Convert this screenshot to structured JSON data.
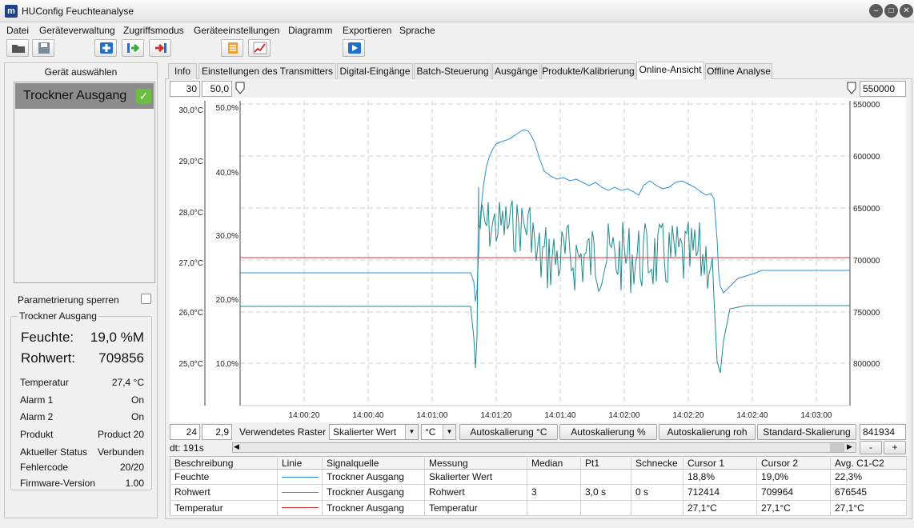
{
  "window": {
    "logo": "m",
    "title": "HUConfig Feuchteanalyse",
    "minimize_icon": "minimize-icon",
    "maximize_icon": "maximize-icon",
    "close_icon": "close-icon"
  },
  "menu": [
    "Datei",
    "Geräteverwaltung",
    "Zugriffsmodus",
    "Geräteeinstellungen",
    "Diagramm",
    "Exportieren",
    "Sprache"
  ],
  "toolbar": [
    "folder-open-icon",
    "save-icon",
    "add-device-icon",
    "import-icon",
    "export-icon",
    "report-icon",
    "chart-icon",
    "play-icon"
  ],
  "left": {
    "select_title": "Gerät auswählen",
    "device_name": "Trockner Ausgang",
    "lock_label": "Parametrierung sperren",
    "group_title": "Trockner Ausgang",
    "moisture_label": "Feuchte:",
    "moisture_value": "19,0 %M",
    "raw_label": "Rohwert:",
    "raw_value": "709856",
    "details": [
      {
        "k": "Temperatur",
        "v": "27,4 °C"
      },
      {
        "k": "Alarm 1",
        "v": "On"
      },
      {
        "k": "Alarm 2",
        "v": "On"
      },
      {
        "k": "Produkt",
        "v": "Product 20"
      },
      {
        "k": "Aktueller Status",
        "v": "Verbunden"
      },
      {
        "k": "Fehlercode",
        "v": "20/20"
      },
      {
        "k": "Firmware-Version",
        "v": "1.00"
      }
    ]
  },
  "tabs": [
    "Info",
    "Einstellungen des Transmitters",
    "Digital-Eingänge",
    "Batch-Steuerung",
    "Ausgänge",
    "Produkte/Kalibrierung",
    "Online-Ansicht",
    "Offline Analyse"
  ],
  "active_tab": "Online-Ansicht",
  "top_fields": {
    "temp_max": "30",
    "pct_max": "50,0",
    "raw_min": "550000"
  },
  "bottom_fields": {
    "temp_min": "24",
    "pct_min": "2,9",
    "raw_max": "841934"
  },
  "controls": {
    "grid_label": "Verwendetes Raster",
    "grid_select": "Skalierter Wert",
    "unit_select": "°C",
    "btn_autoscale_c": "Autoskalierung °C",
    "btn_autoscale_pct": "Autoskalierung %",
    "btn_autoscale_raw": "Autoskalierung roh",
    "btn_standard": "Standard-Skalierung",
    "dt": "dt: 191s",
    "minus": "-",
    "plus": "+"
  },
  "table": {
    "headers": [
      "Beschreibung",
      "Linie",
      "Signalquelle",
      "Messung",
      "Median",
      "Pt1",
      "Schnecke",
      "Cursor 1",
      "Cursor 2",
      "Avg. C1-C2"
    ],
    "rows": [
      [
        "Feuchte",
        "",
        "Trockner Ausgang",
        "Skalierter Wert",
        "",
        "",
        "",
        "18,8%",
        "19,0%",
        "22,3%"
      ],
      [
        "Rohwert",
        "",
        "Trockner Ausgang",
        "Rohwert",
        "3",
        "3,0 s",
        "0 s",
        "712414",
        "709964",
        "676545"
      ],
      [
        "Temperatur",
        "",
        "Trockner Ausgang",
        "Temperatur",
        "",
        "",
        "",
        "27,1°C",
        "27,1°C",
        "27,1°C"
      ]
    ],
    "line_colors": [
      "#2a90d8",
      "#2a90d8",
      "#e03030"
    ]
  },
  "chart_data": {
    "type": "line",
    "x_ticks": [
      "14:00:20",
      "14:00:40",
      "14:01:00",
      "14:01:20",
      "14:01:40",
      "14:02:00",
      "14:02:20",
      "14:02:40",
      "14:03:00"
    ],
    "y_left_temp_ticks": [
      "30,0°C",
      "29,0°C",
      "28,0°C",
      "27,0°C",
      "26,0°C",
      "25,0°C"
    ],
    "y_left_pct_ticks": [
      "50,0%",
      "40,0%",
      "30,0%",
      "20,0%",
      "10,0%"
    ],
    "y_right_raw_ticks": [
      "550000",
      "600000",
      "650000",
      "700000",
      "750000",
      "800000"
    ],
    "temp_range": [
      24,
      30
    ],
    "pct_range": [
      2.9,
      50
    ],
    "raw_range": [
      550000,
      841934
    ],
    "grid": true,
    "series": [
      {
        "color": "#2a90d8"
      },
      {
        "color": "#1e8c8c"
      },
      {
        "color": "#e03030"
      }
    ]
  }
}
